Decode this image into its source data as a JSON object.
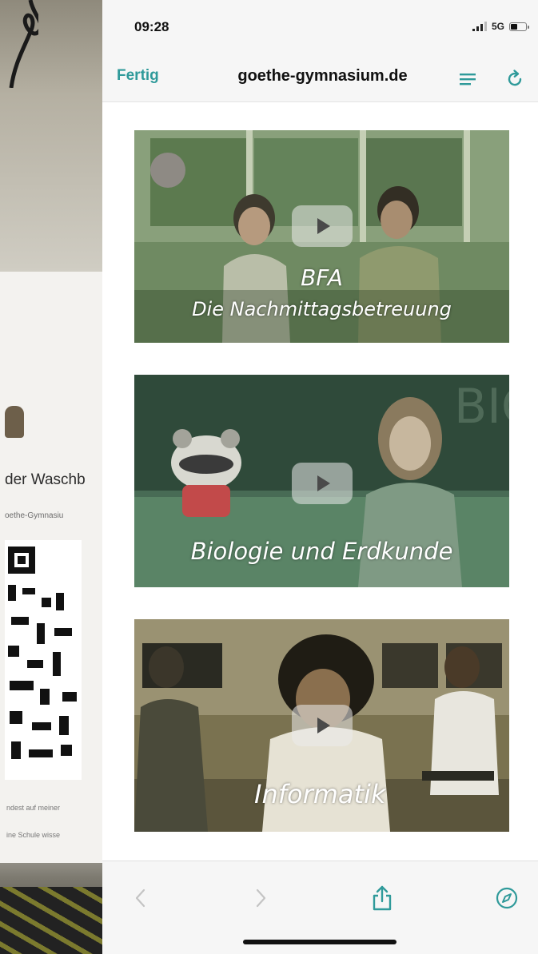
{
  "status_bar": {
    "time": "09:28",
    "network": "5G"
  },
  "nav_bar": {
    "done_label": "Fertig",
    "url": "goethe-gymnasium.de"
  },
  "videos": [
    {
      "caption_line1": "BFA",
      "caption_line2": "Die Nachmittagsbetreuung"
    },
    {
      "caption": "Biologie und Erdkunde"
    },
    {
      "caption": "Informatik"
    }
  ],
  "background_flyer": {
    "word": "der Waschb",
    "sub": "oethe-Gymnasiu",
    "foot1": "ndest auf meiner",
    "foot2": "ine Schule wisse"
  },
  "colors": {
    "accent": "#2f9a9a",
    "card1_tint": "#6f8a62",
    "card2_tint": "#3f6650",
    "card3_tint": "#7a7250"
  },
  "icons": {
    "reader": "reader-mode-icon",
    "reload": "reload-icon",
    "back": "chevron-left-icon",
    "forward": "chevron-right-icon",
    "share": "share-icon",
    "safari": "compass-icon"
  }
}
